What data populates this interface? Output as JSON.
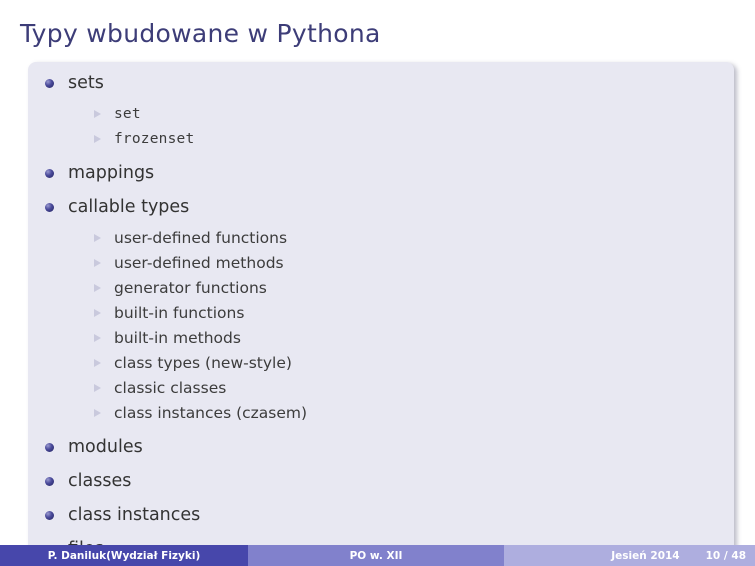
{
  "slide": {
    "title": "Typy wbudowane w Pythona",
    "page_background": "#ffffff",
    "panel_background": "#e8e8f2",
    "title_color": "#3d3d78"
  },
  "content": {
    "items": [
      {
        "label": "sets",
        "children": [
          {
            "label": "set",
            "style": "mono"
          },
          {
            "label": "frozenset",
            "style": "mono"
          }
        ]
      },
      {
        "label": "mappings",
        "children": []
      },
      {
        "label": "callable types",
        "children": [
          {
            "label": "user-defined functions",
            "style": "normal"
          },
          {
            "label": "user-defined methods",
            "style": "normal"
          },
          {
            "label": "generator functions",
            "style": "normal"
          },
          {
            "label": "built-in functions",
            "style": "normal"
          },
          {
            "label": "built-in methods",
            "style": "normal"
          },
          {
            "label": "class types (new-style)",
            "style": "normal"
          },
          {
            "label": "classic classes",
            "style": "normal"
          },
          {
            "label": "class instances (czasem)",
            "style": "normal"
          }
        ]
      },
      {
        "label": "modules",
        "children": []
      },
      {
        "label": "classes",
        "children": []
      },
      {
        "label": "class instances",
        "children": []
      },
      {
        "label": "files",
        "children": []
      }
    ],
    "bullet_icon": "ball-bullet-icon",
    "subbullet_icon": "triangle-bullet-icon"
  },
  "footer": {
    "author": "P. Daniluk(Wydział Fizyki)",
    "presentation_title": "PO w. XII",
    "date": "Jesień 2014",
    "page_number": "10 / 48",
    "author_bg": "#4747ab",
    "title_bg": "#8181cc",
    "meta_bg": "#aeaedf"
  }
}
